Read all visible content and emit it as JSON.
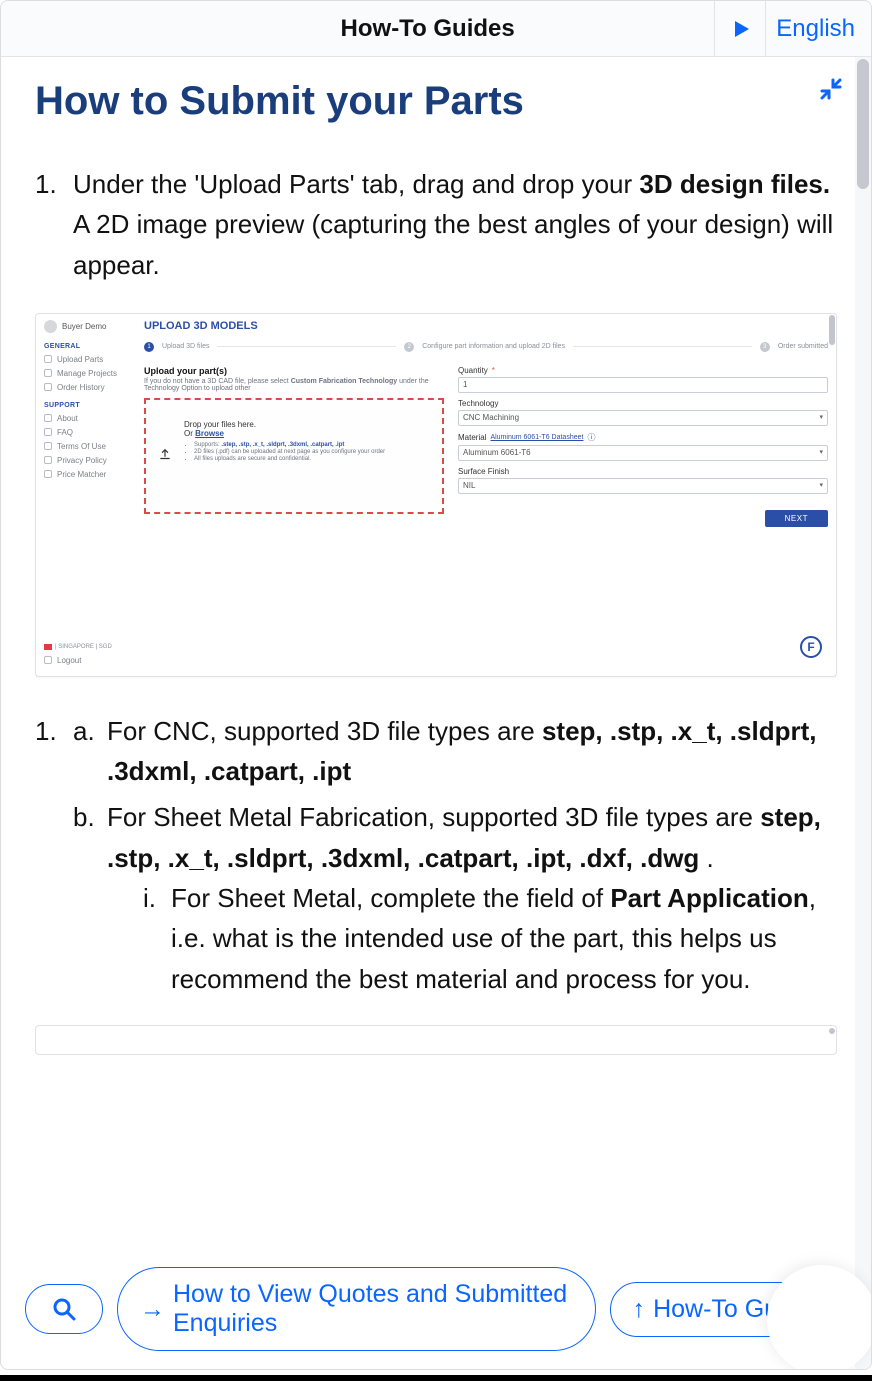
{
  "topbar": {
    "title": "How-To Guides",
    "language": "English"
  },
  "page": {
    "title": "How to Submit your Parts"
  },
  "steps": {
    "s1_pre": "Under the 'Upload Parts' tab, drag and drop your ",
    "s1_bold": "3D design files.",
    "s1_post": " A 2D image preview (capturing the best angles of your design) will appear.",
    "sub_a_pre": "For CNC, supported 3D file types are ",
    "sub_a_bold": "step, .stp, .x_t, .sldprt, .3dxml, .catpart, .ipt",
    "sub_b_pre": "For Sheet Metal Fabrication, supported 3D file types are ",
    "sub_b_bold": "step, .stp, .x_t, .sldprt, .3dxml, .catpart, .ipt, .dxf, .dwg",
    "sub_b_post": " .",
    "sub_i_pre": "For Sheet Metal, complete the field of ",
    "sub_i_bold": "Part Application",
    "sub_i_post": ", i.e. what is the intended use of the part, this helps us recommend the best material and process for you."
  },
  "screenshot": {
    "user_name": "Buyer Demo",
    "heading": "UPLOAD 3D MODELS",
    "step1": "Upload 3D files",
    "step2": "Configure part information and upload 2D files",
    "step3": "Order submitted",
    "upload_label": "Upload your part(s)",
    "upload_sub_pre": "If you do not have a 3D CAD file, please select ",
    "upload_sub_bold": "Custom Fabrication Technology",
    "upload_sub_post": " under the Technology Option to upload other",
    "drop_line1": "Drop your files here.",
    "drop_or": "Or ",
    "drop_browse": "Browse",
    "drop_supports": "Supports: ",
    "drop_formats": ".step, .stp, .x_t, .sldprt, .3dxml, .catpart, .ipt",
    "drop_b2": "2D files (.pdf) can be uploaded at next page as you configure your order",
    "drop_b3": "All files uploads are secure and confidential.",
    "qty_label": "Quantity",
    "qty_value": "1",
    "tech_label": "Technology",
    "tech_value": "CNC Machining",
    "mat_label": "Material",
    "mat_link": "Aluminum 6061-T6 Datasheet",
    "mat_value": "Aluminum 6061-T6",
    "sf_label": "Surface Finish",
    "sf_value": "NIL",
    "next": "NEXT",
    "sidebar": {
      "general": "GENERAL",
      "support": "SUPPORT",
      "items_general": [
        "Upload Parts",
        "Manage Projects",
        "Order History"
      ],
      "items_support": [
        "About",
        "FAQ",
        "Terms Of Use",
        "Privacy Policy",
        "Price Matcher"
      ],
      "locale": "| SINGAPORE | SGD",
      "logout": "Logout"
    }
  },
  "nav": {
    "next_label": "How to View Quotes and Submitted Enquiries",
    "up_label": "How-To Guides"
  }
}
